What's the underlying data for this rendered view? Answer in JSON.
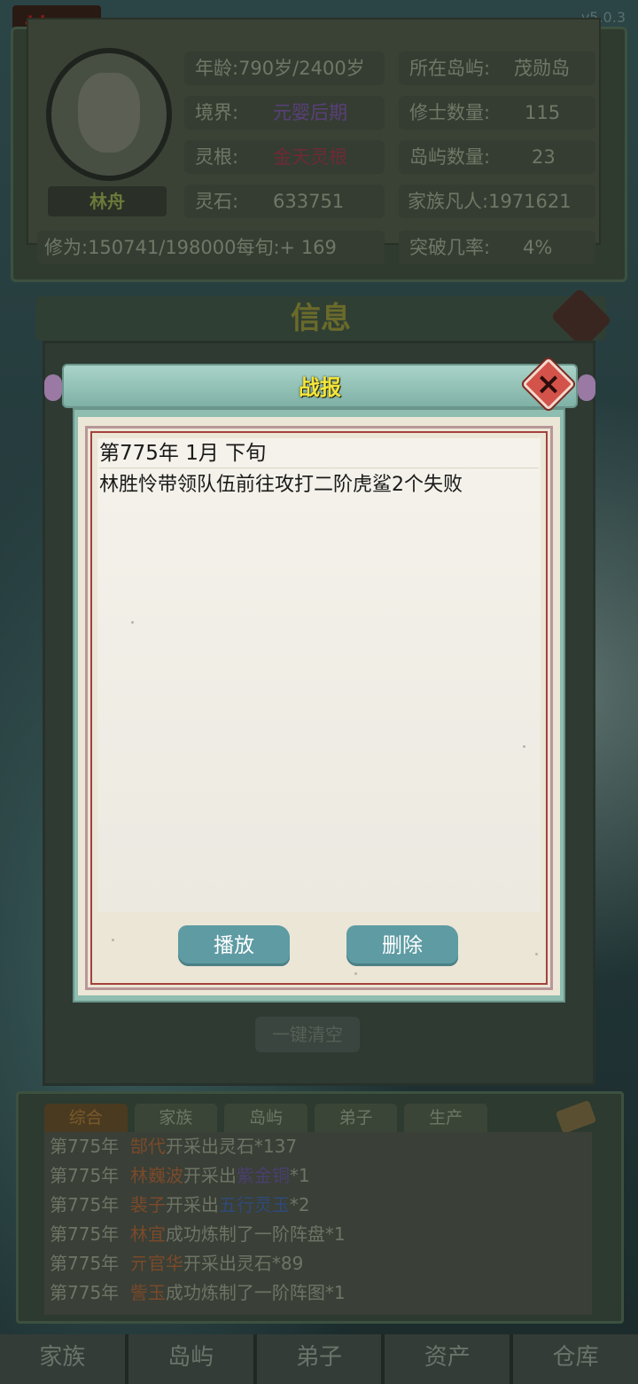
{
  "status": {
    "realm_char": "地",
    "realm_sub": "狱",
    "version": "v5.0.3"
  },
  "character": {
    "name": "林舟",
    "age_label": "年龄:790岁/2400岁",
    "realm_label": "境界:",
    "realm_value": "元婴后期",
    "root_label": "灵根:",
    "root_value": "金天灵根",
    "stone_label": "灵石:",
    "stone_value": "633751",
    "cultivation": "修为:150741/198000每旬:+ 169"
  },
  "island": {
    "location_label": "所在岛屿:",
    "location_value": "茂勋岛",
    "cultivators_label": "修士数量:",
    "cultivators_value": "115",
    "islands_label": "岛屿数量:",
    "islands_value": "23",
    "mortals_label": "家族凡人:",
    "mortals_value": "1971621",
    "breakthrough_label": "突破几率:",
    "breakthrough_value": "4%"
  },
  "info_panel": {
    "title": "信息",
    "clear_all": "一键清空"
  },
  "modal": {
    "title": "战报",
    "date": "第775年 1月 下旬",
    "message": "林胜怜带领队伍前往攻打二阶虎鲨2个失败",
    "play_button": "播放",
    "delete_button": "删除"
  },
  "log": {
    "tabs": [
      "综合",
      "家族",
      "岛屿",
      "弟子",
      "生产"
    ],
    "entries": [
      {
        "year": "第775年",
        "name": "郜代",
        "action": "开采出灵石*137",
        "item": "",
        "suffix": ""
      },
      {
        "year": "第775年",
        "name": "林巍波",
        "action": "开采出",
        "item": "紫金铜",
        "suffix": "*1"
      },
      {
        "year": "第775年",
        "name": "裴子",
        "action": "开采出",
        "item": "五行灵玉",
        "suffix": "*2"
      },
      {
        "year": "第775年",
        "name": "林宜",
        "action": "成功炼制了一阶阵盘*1",
        "item": "",
        "suffix": ""
      },
      {
        "year": "第775年",
        "name": "亓官华",
        "action": "开采出灵石*89",
        "item": "",
        "suffix": ""
      },
      {
        "year": "第775年",
        "name": "訾玉",
        "action": "成功炼制了一阶阵图*1",
        "item": "",
        "suffix": ""
      }
    ]
  },
  "nav": [
    "家族",
    "岛屿",
    "弟子",
    "资产",
    "仓库"
  ],
  "colors": {
    "modal_title": "#f3e63a",
    "close_button": "#d3534a",
    "action_button": "#5e9ba3"
  }
}
